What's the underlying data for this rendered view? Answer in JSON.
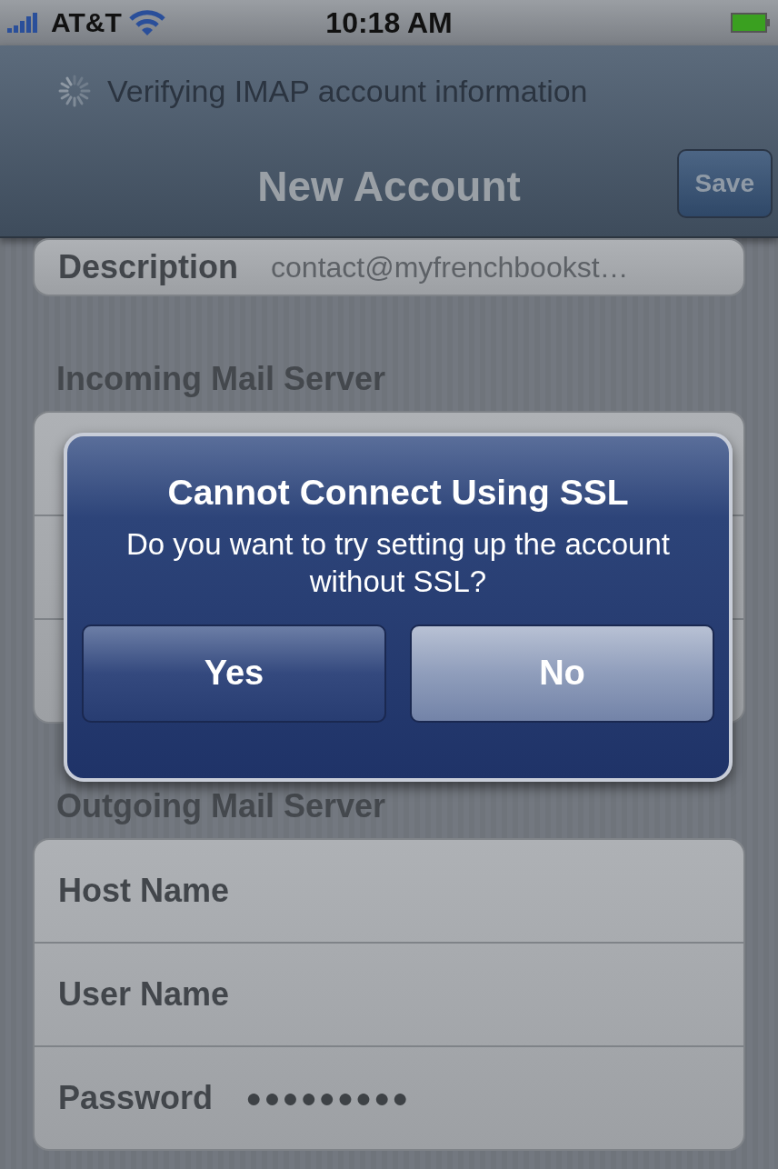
{
  "status_bar": {
    "carrier": "AT&T",
    "time": "10:18 AM"
  },
  "nav_bar": {
    "prompt": "Verifying IMAP account information",
    "title": "New Account",
    "save_button": "Save"
  },
  "description_row": {
    "label": "Description",
    "value": "contact@myfrenchbookst…"
  },
  "incoming_section": {
    "header": "Incoming Mail Server"
  },
  "alert": {
    "title": "Cannot Connect Using SSL",
    "message": "Do you want to try setting up the account without SSL?",
    "buttons": [
      {
        "label": "Yes",
        "selected": false
      },
      {
        "label": "No",
        "selected": true
      }
    ]
  },
  "outgoing_section": {
    "header": "Outgoing Mail Server",
    "rows": [
      {
        "label": "Host Name"
      },
      {
        "label": "User Name"
      },
      {
        "label": "Password",
        "value": "●●●●●●●●●"
      }
    ]
  }
}
